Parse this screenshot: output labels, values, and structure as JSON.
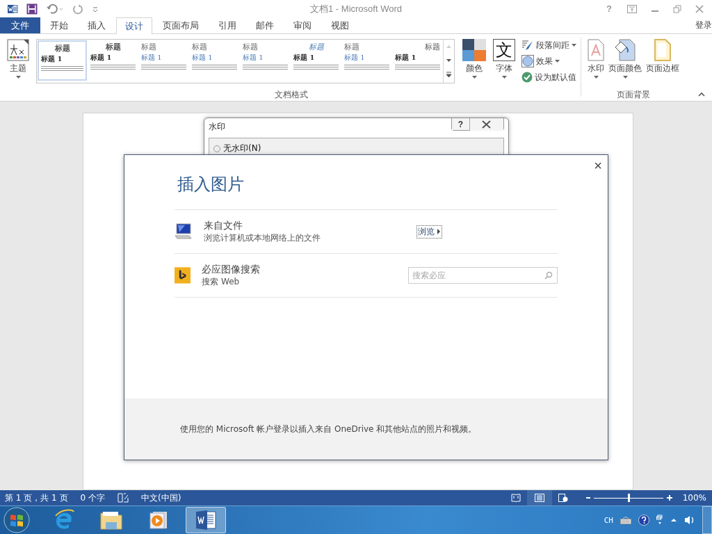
{
  "title_bar": {
    "title": "文档1 - Microsoft Word",
    "help": "?"
  },
  "tabs": [
    {
      "label": "文件",
      "kind": "file",
      "selected": false
    },
    {
      "label": "开始",
      "kind": "tab",
      "selected": false
    },
    {
      "label": "插入",
      "kind": "tab",
      "selected": false
    },
    {
      "label": "设计",
      "kind": "tab",
      "selected": true
    },
    {
      "label": "页面布局",
      "kind": "tab",
      "selected": false
    },
    {
      "label": "引用",
      "kind": "tab",
      "selected": false
    },
    {
      "label": "邮件",
      "kind": "tab",
      "selected": false
    },
    {
      "label": "审阅",
      "kind": "tab",
      "selected": false
    },
    {
      "label": "视图",
      "kind": "tab",
      "selected": false
    }
  ],
  "sign_in": "登录",
  "ribbon": {
    "theme_button": "主题",
    "gallery": [
      {
        "heading": "标题",
        "subheading": "标题 1",
        "kind": "classic",
        "selected": true
      },
      {
        "heading": "标题",
        "subheading": "标题 1",
        "kind": "classic",
        "selected": false
      },
      {
        "heading": "标题",
        "subheading": "标题 1",
        "kind": "left",
        "selected": false
      },
      {
        "heading": "标题",
        "subheading": "标题 1",
        "kind": "left",
        "selected": false
      },
      {
        "heading": "标题",
        "subheading": "标题 1",
        "kind": "left",
        "selected": false
      },
      {
        "heading": "标题",
        "subheading": "标题 1",
        "kind": "italic",
        "selected": false
      },
      {
        "heading": "标题",
        "subheading": "标题 1",
        "kind": "left",
        "selected": false
      },
      {
        "heading": "标题",
        "subheading": "标题 1",
        "kind": "right",
        "selected": false
      }
    ],
    "gallery_group": "文档格式",
    "colors_button": "颜色",
    "fonts_button": "字体",
    "font_glyph": "文",
    "paragraph_spacing": "段落间距",
    "effects": "效果",
    "set_default": "设为默认值",
    "page_buttons": [
      {
        "label": "水印",
        "kind": "watermark"
      },
      {
        "label": "页面颜色",
        "kind": "color"
      },
      {
        "label": "页面边框",
        "kind": "border"
      }
    ],
    "page_group": "页面背景"
  },
  "watermark_dialog": {
    "title": "水印",
    "help": "?",
    "option": {
      "label": "无水印(N)",
      "selected": false
    }
  },
  "insert_picture_dialog": {
    "title": "插入图片",
    "close": "×",
    "sources": [
      {
        "kind": "file",
        "title": "来自文件",
        "subtitle": "浏览计算机或本地网络上的文件",
        "action": "浏览"
      },
      {
        "kind": "bing",
        "title": "必应图像搜索",
        "subtitle": "搜索 Web",
        "placeholder": "搜索必应"
      }
    ],
    "footer": "使用您的 Microsoft 帐户登录以插入来自 OneDrive 和其他站点的照片和视频。"
  },
  "status_bar": {
    "page": "第 1 页，共 1 页",
    "words": "0 个字",
    "language": "中文(中国)",
    "views": [
      {
        "kind": "read",
        "selected": false
      },
      {
        "kind": "print",
        "selected": true
      },
      {
        "kind": "web",
        "selected": false
      }
    ],
    "zoom": {
      "level": 0.5,
      "reading": "100%"
    }
  },
  "taskbar": {
    "apps": [
      {
        "kind": "ie",
        "selected": false
      },
      {
        "kind": "explorer",
        "selected": false
      },
      {
        "kind": "media",
        "selected": false
      },
      {
        "kind": "word",
        "selected": true
      }
    ],
    "language": "CH"
  }
}
